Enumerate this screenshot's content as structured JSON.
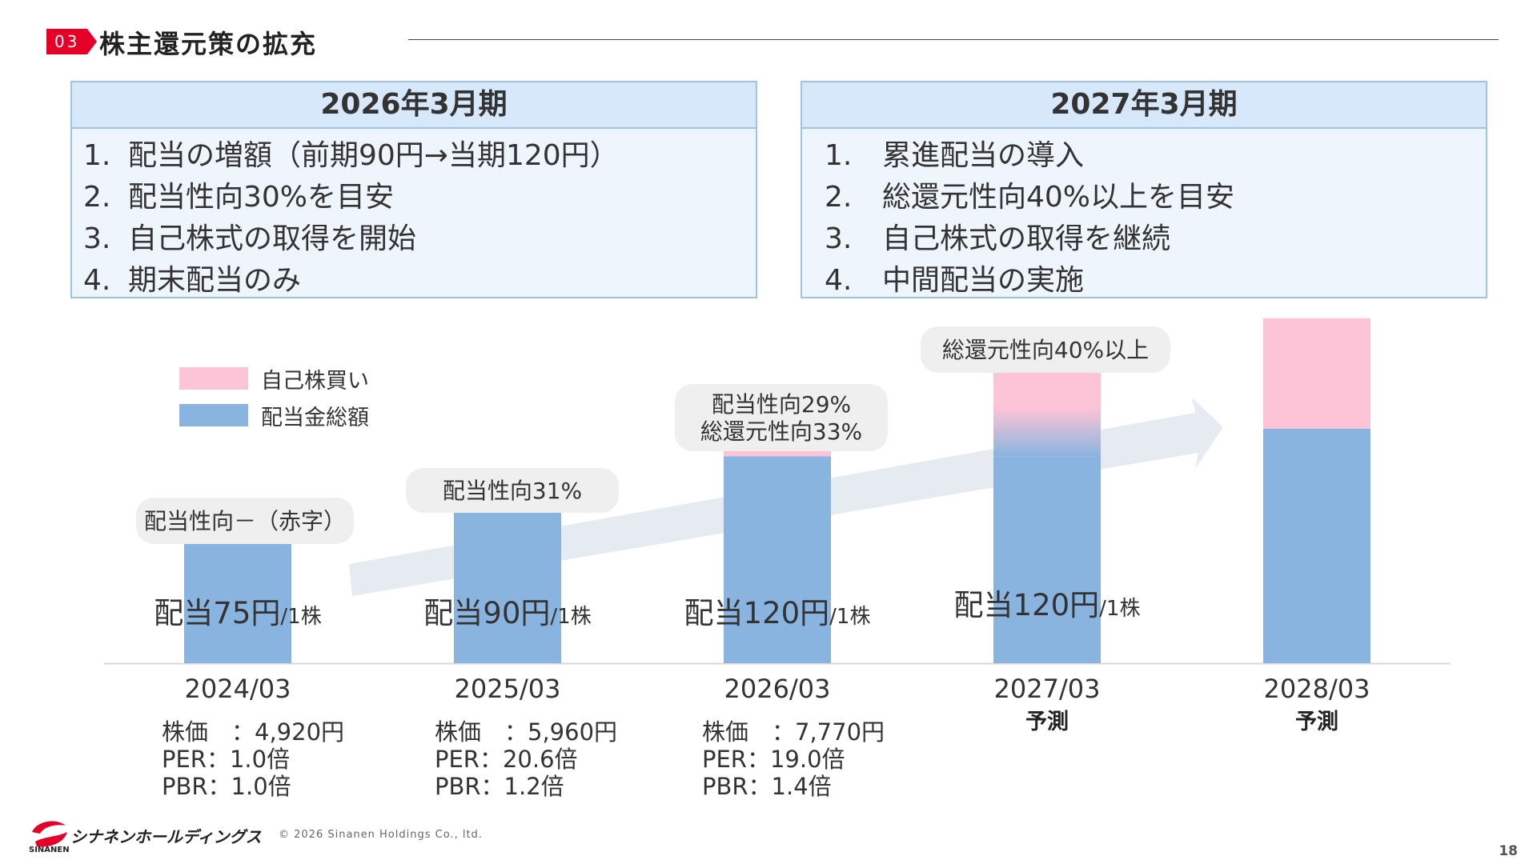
{
  "header": {
    "section_number": "03",
    "title": "株主還元策の拡充"
  },
  "boxes": [
    {
      "title": "2026年3月期",
      "items": [
        {
          "num": "1.",
          "text": "配当の増額（前期90円→当期120円）"
        },
        {
          "num": "2.",
          "text": "配当性向30%を目安"
        },
        {
          "num": "3.",
          "text": "自己株式の取得を開始"
        },
        {
          "num": "4.",
          "text": "期末配当のみ"
        }
      ]
    },
    {
      "title": "2027年3月期",
      "items": [
        {
          "num": "1.",
          "text": "累進配当の導入"
        },
        {
          "num": "2.",
          "text": "総還元性向40%以上を目安"
        },
        {
          "num": "3.",
          "text": "自己株式の取得を継続"
        },
        {
          "num": "4.",
          "text": "中間配当の実施"
        }
      ]
    }
  ],
  "legend": {
    "buyback": "自己株買い",
    "dividend": "配当金総額"
  },
  "colors": {
    "dividend": "#8ab4e0",
    "buyback": "#fcc4d6",
    "callout_bg": "#efefef",
    "arrow": "#e6ebf2",
    "accent_red": "#e60027",
    "box_border": "#9cc3ea",
    "box_head": "#d6e8f9",
    "box_body": "#eef5fc"
  },
  "chart_data": {
    "type": "bar",
    "stacked": true,
    "categories": [
      "2024/03",
      "2025/03",
      "2026/03",
      "2027/03",
      "2028/03"
    ],
    "category_notes": [
      "",
      "",
      "",
      "予測",
      "予測"
    ],
    "series": [
      {
        "name": "配当金総額",
        "values": [
          28,
          34,
          45,
          45,
          51
        ]
      },
      {
        "name": "自己株買い",
        "values": [
          0,
          0,
          5,
          24,
          24
        ]
      }
    ],
    "ylim": [
      0,
      80
    ],
    "grid": false,
    "legend_position": "top-left",
    "dividend_labels": [
      {
        "main": "配当75円",
        "unit": "/1株"
      },
      {
        "main": "配当90円",
        "unit": "/1株"
      },
      {
        "main": "配当120円",
        "unit": "/1株"
      },
      {
        "main": "配当120円",
        "unit": "/1株"
      },
      {
        "main": "",
        "unit": ""
      }
    ],
    "callouts": [
      [
        "配当性向－（赤字）"
      ],
      [
        "配当性向31%"
      ],
      [
        "配当性向29%",
        "総還元性向33%"
      ],
      [
        "総還元性向40%以上"
      ],
      []
    ],
    "trend_arrow": true
  },
  "stats": [
    {
      "price": "株価　：4,920円",
      "per": "PER：1.0倍",
      "pbr": "PBR：1.0倍"
    },
    {
      "price": "株価　：5,960円",
      "per": "PER：20.6倍",
      "pbr": "PBR：1.2倍"
    },
    {
      "price": "株価　：7,770円",
      "per": "PER：19.0倍",
      "pbr": "PBR：1.4倍"
    }
  ],
  "footer": {
    "company": "シナネンホールディングス",
    "company_en": "SINANEN",
    "copyright": "© 2026 Sinanen Holdings Co., ltd.",
    "page": "18"
  }
}
